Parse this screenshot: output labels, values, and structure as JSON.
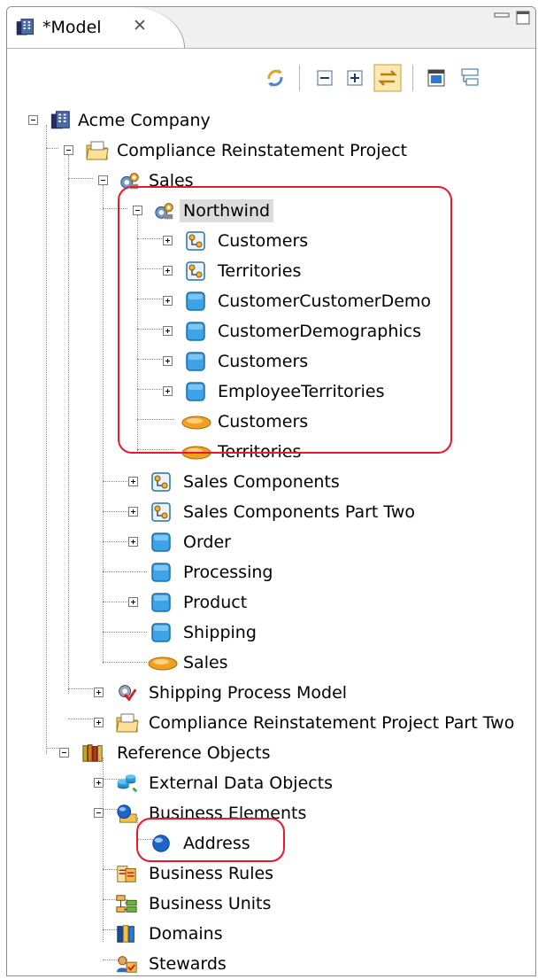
{
  "tab": {
    "title": "*Model",
    "close_glyph": "✕",
    "icon": "model-icon"
  },
  "window": {
    "minimize_icon": "minimize-icon",
    "maximize_icon": "maximize-icon"
  },
  "toolbar": {
    "buttons": [
      "sync-icon",
      "collapse-all-icon",
      "expand-all-icon",
      "link-with-editor-icon",
      "view-menu-icon",
      "tree-layout-icon"
    ]
  },
  "tree": {
    "root": "Acme Company",
    "project": "Compliance Reinstatement  Project",
    "sales": "Sales",
    "northwind": "Northwind",
    "nw_items": [
      "Customers",
      "Territories",
      "CustomerCustomerDemo",
      "CustomerDemographics",
      "Customers",
      "EmployeeTerritories",
      "Customers",
      "Territories"
    ],
    "sales_items": [
      "Sales Components",
      "Sales Components Part Two",
      "Order",
      "Processing",
      "Product",
      "Shipping",
      "Sales"
    ],
    "shipping_model": "Shipping Process Model",
    "project2": "Compliance Reinstatement Project Part Two",
    "reference": "Reference Objects",
    "external": "External Data Objects",
    "business_elements": "Business Elements",
    "address": "Address",
    "ref_items": [
      "Business Rules",
      "Business Units",
      "Domains",
      "Stewards"
    ]
  },
  "colors": {
    "highlight": "#e8192c",
    "table_blue": "#3ea3e6",
    "entity_orange": "#f0a020",
    "selection": "#dcdcdc"
  }
}
